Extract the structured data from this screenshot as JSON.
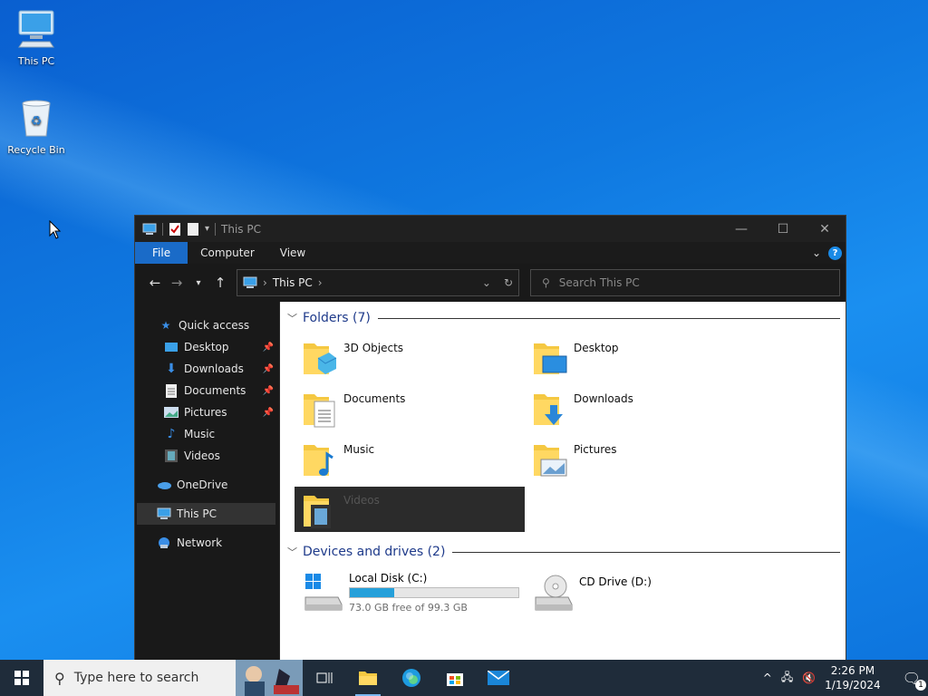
{
  "desktop": {
    "icons": [
      {
        "label": "This PC"
      },
      {
        "label": "Recycle Bin"
      }
    ]
  },
  "window": {
    "title": "This PC",
    "ribbon_tabs": [
      "File",
      "Computer",
      "View"
    ],
    "help_glyph": "?",
    "address": {
      "location": "This PC"
    },
    "search": {
      "placeholder": "Search This PC"
    },
    "nav": {
      "quick_access": "Quick access",
      "quick_items": [
        "Desktop",
        "Downloads",
        "Documents",
        "Pictures",
        "Music",
        "Videos"
      ],
      "onedrive": "OneDrive",
      "this_pc": "This PC",
      "network": "Network"
    },
    "folders_header": "Folders (7)",
    "folders": [
      "3D Objects",
      "Desktop",
      "Documents",
      "Downloads",
      "Music",
      "Pictures",
      "Videos"
    ],
    "devices_header": "Devices and drives (2)",
    "drives": {
      "c": {
        "name": "Local Disk (C:)",
        "free": "73.0 GB free of 99.3 GB",
        "used_fraction": 0.265
      },
      "d": {
        "name": "CD Drive (D:)"
      }
    }
  },
  "taskbar": {
    "search_placeholder": "Type here to search",
    "time": "2:26 PM",
    "date": "1/19/2024",
    "notification_count": "1"
  },
  "colors": {
    "accent": "#1a6bc8",
    "progress": "#26a0da",
    "group_header": "#1e3a8a"
  }
}
